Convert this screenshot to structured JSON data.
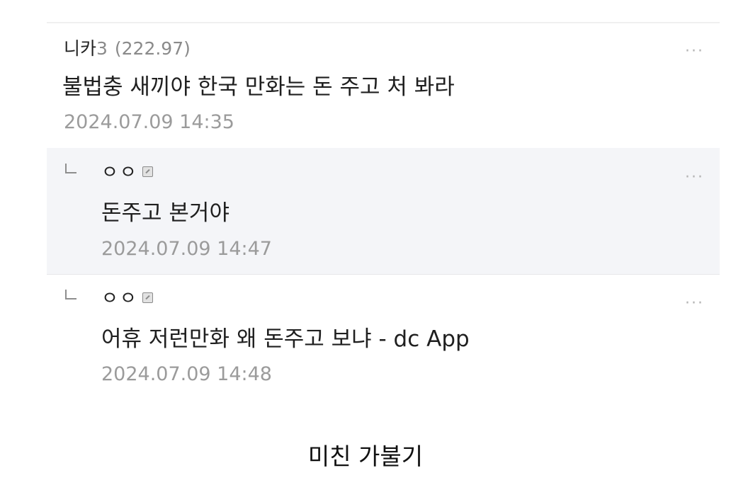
{
  "comments": [
    {
      "nick": "니카",
      "nick_suffix": "3",
      "ip": "(222.97)",
      "text": "불법충 새끼야 한국 만화는 돈 주고 처 봐라",
      "date": "2024.07.09 14:35",
      "more": "···"
    },
    {
      "nick": "ㅇㅇ",
      "text": "돈주고 본거야",
      "date": "2024.07.09 14:47",
      "more": "···",
      "icon": "gallog-icon"
    },
    {
      "nick": "ㅇㅇ",
      "text": "어휴 저런만화 왜 돈주고 보냐 - dc App",
      "date": "2024.07.09 14:48",
      "more": "···",
      "icon": "gallog-icon"
    }
  ],
  "caption": "미친 가불기",
  "colors": {
    "reply_background": "#f4f5f8",
    "date_text": "#9b9b9b",
    "ip_text": "#8a8a8a"
  }
}
